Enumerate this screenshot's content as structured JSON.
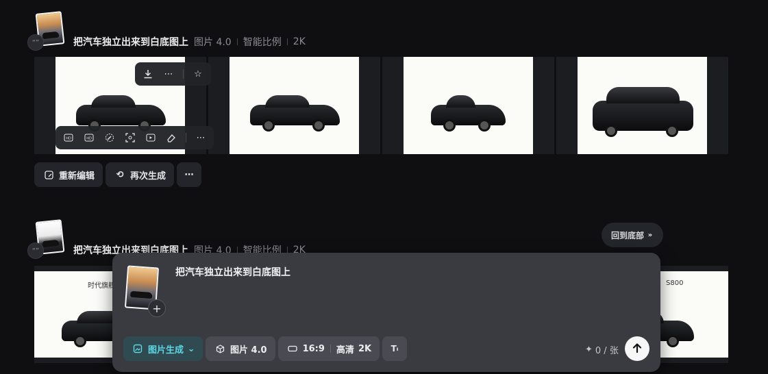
{
  "generations": [
    {
      "prompt": "把汽车独立出来到白底图上",
      "model": "图片 4.0",
      "ratio": "智能比例",
      "resolution": "2K",
      "badge": "“”"
    },
    {
      "prompt": "把汽车独立出来到白底图上",
      "model": "图片 4.0",
      "ratio": "智能比例",
      "resolution": "2K",
      "badge": "“”",
      "visible_captions": [
        "时代旗舰",
        "S800"
      ]
    }
  ],
  "image_toolbar": {
    "download_icon": "download-icon",
    "more_icon": "more-icon",
    "favorite_icon": "star-icon"
  },
  "edit_tools": {
    "labels": [
      "HD",
      "HD",
      "",
      "",
      "",
      ""
    ],
    "icons": [
      "expand-icon",
      "hd-icon",
      "inpaint-icon",
      "crop-focus-icon",
      "video-icon",
      "eraser-icon",
      "more-icon"
    ]
  },
  "actions": {
    "reedit_label": "重新编辑",
    "regenerate_label": "再次生成"
  },
  "scroll_bottom_label": "回到底部",
  "composer": {
    "prompt": "把汽车独立出来到白底图上",
    "mode_label": "图片生成",
    "model_label": "图片 4.0",
    "ratio_label": "16:9",
    "quality_label": "高清",
    "resolution_label": "2K",
    "credits": "0 / 张",
    "add_symbol": "+",
    "send_icon": "arrow-up-icon"
  },
  "colors": {
    "background": "#0f0f11",
    "composer": "#3a3b41",
    "accent": "#5fd6e4"
  }
}
